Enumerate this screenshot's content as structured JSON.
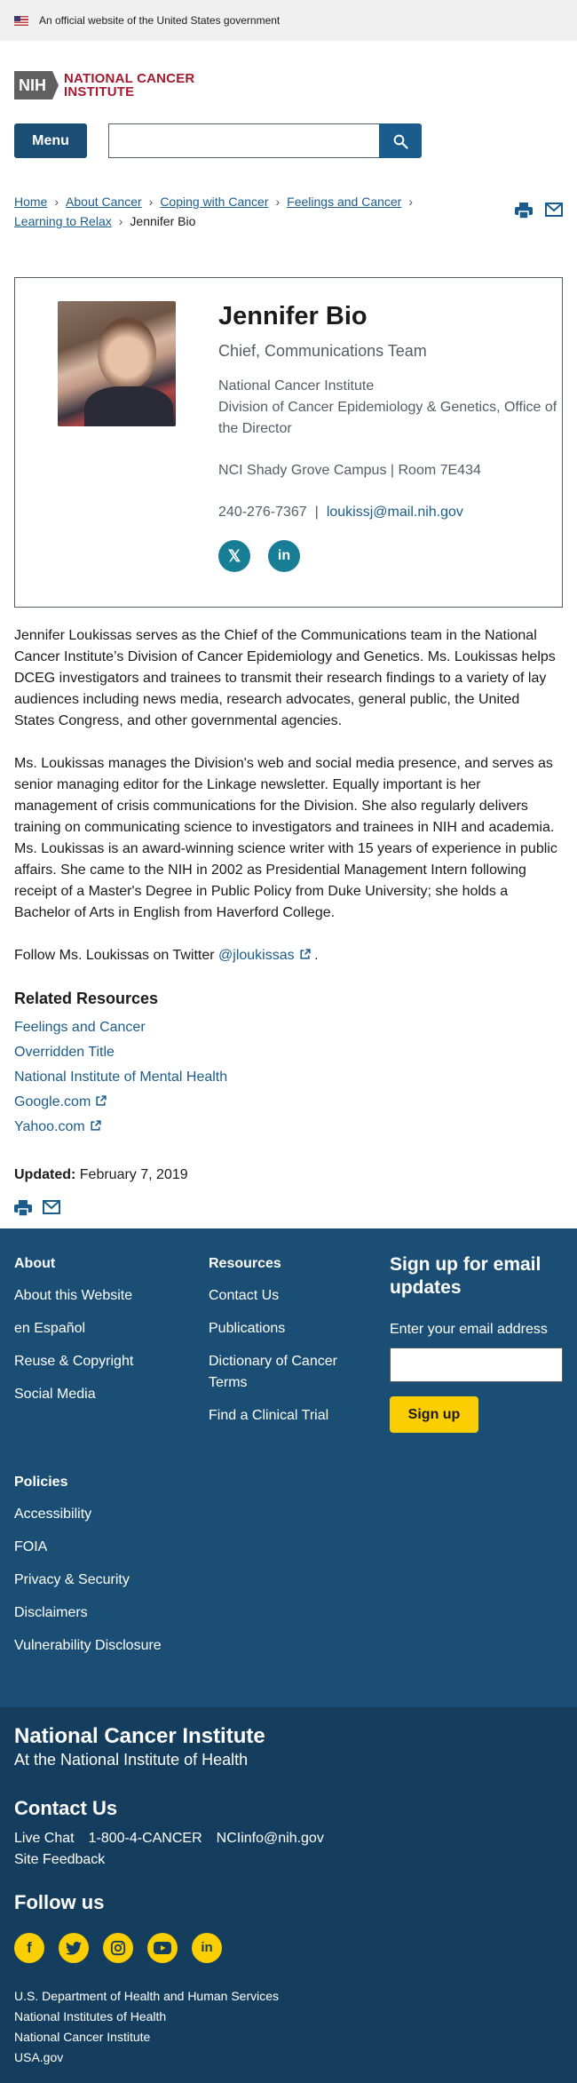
{
  "gov_banner": {
    "text": "An official website of the United States government"
  },
  "header": {
    "logo_abbr": "NIH",
    "logo_line1": "NATIONAL CANCER",
    "logo_line2": "INSTITUTE",
    "menu_label": "Menu",
    "search_placeholder": ""
  },
  "breadcrumb": {
    "items": [
      "Home",
      "About Cancer",
      "Coping with Cancer",
      "Feelings and Cancer",
      "Learning to Relax"
    ],
    "current": "Jennifer Bio"
  },
  "profile": {
    "name": "Jennifer Bio",
    "title": "Chief, Communications Team",
    "org_line1": "National Cancer Institute",
    "org_line2": "Division of Cancer Epidemiology & Genetics, Office of the Director",
    "location": "NCI Shady Grove Campus | Room 7E434",
    "phone": "240-276-7367",
    "email": "loukissj@mail.nih.gov"
  },
  "bio": {
    "p1": "Jennifer Loukissas serves as the Chief of the Communications team in the National Cancer Institute’s Division of Cancer Epidemiology and Genetics. Ms. Loukissas helps DCEG investigators and trainees to transmit their research findings to a variety of lay audiences including news media, research advocates, general public, the United States Congress, and other governmental agencies.",
    "p2": "Ms. Loukissas manages the Division's web and social media presence, and serves as senior managing editor for the Linkage newsletter. Equally important is her management of crisis communications for the Division. She also regularly delivers training on communicating science to investigators and trainees in NIH and academia. Ms. Loukissas is an award-winning science writer with 15 years of experience in public affairs. She came to the NIH in 2002 as Presidential Management Intern following receipt of a Master's Degree in Public Policy from Duke University; she holds a Bachelor of Arts in English from Haverford College.",
    "follow_prefix": "Follow Ms. Loukissas on Twitter",
    "twitter_handle": "@jloukissas",
    "follow_suffix": "."
  },
  "related": {
    "heading": "Related Resources",
    "links": [
      "Feelings and Cancer",
      "Overridden Title",
      "National Institute of Mental Health",
      "Google.com",
      "Yahoo.com"
    ]
  },
  "updated": {
    "label": "Updated:",
    "date": "February 7, 2019"
  },
  "footer": {
    "about_heading": "About",
    "about_links": [
      "About this Website",
      "en Español",
      "Reuse & Copyright",
      "Social Media"
    ],
    "resources_heading": "Resources",
    "resources_links": [
      "Contact Us",
      "Publications",
      "Dictionary of Cancer Terms",
      "Find a Clinical Trial"
    ],
    "signup_title": "Sign up for email updates",
    "signup_label": "Enter your email address",
    "signup_button": "Sign up",
    "policies_heading": "Policies",
    "policies_links": [
      "Accessibility",
      "FOIA",
      "Privacy & Security",
      "Disclaimers",
      "Vulnerability Disclosure"
    ]
  },
  "footer2": {
    "title": "National Cancer Institute",
    "subtitle": "At the National Institute of Health",
    "contact_heading": "Contact Us",
    "live_chat": "Live Chat",
    "phone": "1-800-4-CANCER",
    "email": "NCIinfo@nih.gov",
    "feedback": "Site Feedback",
    "follow_heading": "Follow us",
    "agencies": [
      "U.S. Department of Health and Human Services",
      "National Institutes of Health",
      "National Cancer Institute",
      "USA.gov"
    ]
  },
  "colors": {
    "primary": "#1b4e75",
    "link": "#1a5c8c",
    "accent_red": "#a6192e",
    "footer_yellow": "#face00",
    "social_teal": "#177e96"
  },
  "icons": [
    "us-flag-icon",
    "search-icon",
    "print-icon",
    "email-icon",
    "x-twitter-icon",
    "linkedin-icon",
    "external-link-icon",
    "facebook-icon",
    "twitter-icon",
    "instagram-icon",
    "youtube-icon"
  ]
}
